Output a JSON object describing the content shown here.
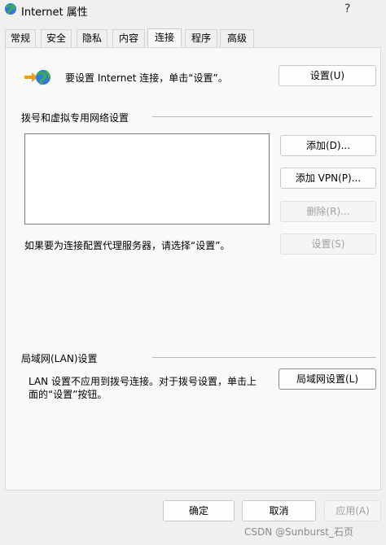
{
  "window": {
    "title": "Internet 属性",
    "help": "?"
  },
  "tabs": [
    {
      "label": "常规"
    },
    {
      "label": "安全"
    },
    {
      "label": "隐私"
    },
    {
      "label": "内容"
    },
    {
      "label": "连接",
      "active": true
    },
    {
      "label": "程序"
    },
    {
      "label": "高级"
    }
  ],
  "setup": {
    "text": "要设置 Internet 连接，单击“设置”。",
    "button": "设置(U)"
  },
  "dialup": {
    "heading": "拨号和虚拟专用网络设置",
    "add_button": "添加(D)...",
    "add_vpn_button": "添加 VPN(P)...",
    "remove_button": "删除(R)...",
    "proxy_text": "如果要为连接配置代理服务器，请选择“设置”。",
    "settings_button": "设置(S)"
  },
  "lan": {
    "heading": "局域网(LAN)设置",
    "text_line1": "LAN 设置不应用到拨号连接。对于拨号设置，单击上",
    "text_line2": "面的“设置”按钮。",
    "button": "局域网设置(L)"
  },
  "footer": {
    "ok": "确定",
    "cancel": "取消",
    "apply": "应用(A)"
  },
  "watermark": "CSDN @Sunburst_石页",
  "colors": {
    "background": "#f0f0f0",
    "panel": "#f9f9f9",
    "disabled_text": "#a0a0a0"
  },
  "icons": {
    "app": "internet-globe-icon",
    "connection": "globe-connection-icon",
    "help": "help-icon"
  }
}
